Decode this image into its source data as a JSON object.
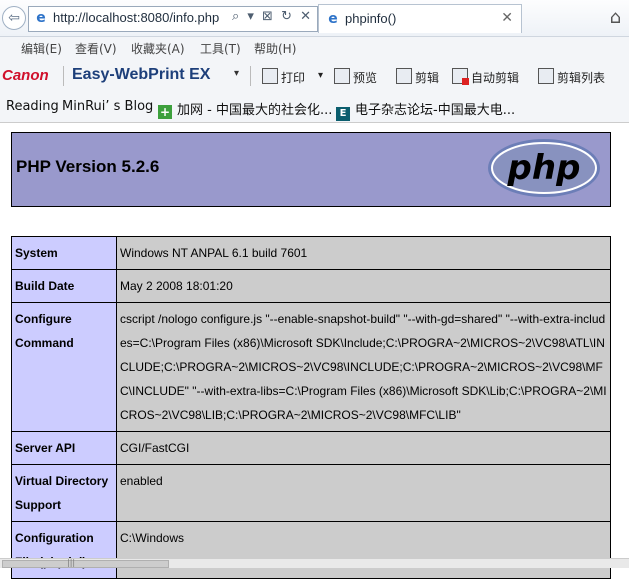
{
  "browser": {
    "url": "http://localhost:8080/info.php",
    "addr_tools": "⌕ ▾ ⊠ ↻ ✕",
    "tab_title": "phpinfo()",
    "tab_close": "✕",
    "home_icon": "⌂",
    "ie_glyph": "e",
    "back_glyph": "⇦"
  },
  "menu": [
    "编辑(E)",
    "查看(V)",
    "收藏夹(A)",
    "工具(T)",
    "帮助(H)"
  ],
  "toolbar": {
    "brand": "Canon",
    "product": "Easy-WebPrint EX",
    "product_arrow": "▾",
    "print": "打印",
    "print_arrow": "▾",
    "preview": "预览",
    "clip": "剪辑",
    "auto_clip": "自动剪辑",
    "clip_list": "剪辑列表"
  },
  "favorites": {
    "item1": "Reading",
    "item2": "MinRui’ s Blog",
    "item3": "加网 - 中国最大的社会化...",
    "item4": "电子杂志论坛-中国最大电...",
    "icon3_glyph": "+",
    "icon4_glyph": "E"
  },
  "page": {
    "title": "PHP Version 5.2.6",
    "logo_text": "php",
    "rows": [
      {
        "key": "System",
        "value": "Windows NT ANPAL 6.1 build 7601"
      },
      {
        "key": "Build Date",
        "value": "May 2 2008 18:01:20"
      },
      {
        "key": "Configure Command",
        "value": "cscript /nologo configure.js \"--enable-snapshot-build\" \"--with-gd=shared\" \"--with-extra-includes=C:\\Program Files (x86)\\Microsoft SDK\\Include;C:\\PROGRA~2\\MICROS~2\\VC98\\ATL\\INCLUDE;C:\\PROGRA~2\\MICROS~2\\VC98\\INCLUDE;C:\\PROGRA~2\\MICROS~2\\VC98\\MFC\\INCLUDE\" \"--with-extra-libs=C:\\Program Files (x86)\\Microsoft SDK\\Lib;C:\\PROGRA~2\\MICROS~2\\VC98\\LIB;C:\\PROGRA~2\\MICROS~2\\VC98\\MFC\\LIB\""
      },
      {
        "key": "Server API",
        "value": "CGI/FastCGI"
      },
      {
        "key": "Virtual Directory Support",
        "value": "enabled"
      },
      {
        "key": "Configuration File (php.ini)",
        "value": "C:\\Windows"
      }
    ]
  },
  "scrollbar": {
    "grip": "|||"
  },
  "colors": {
    "header_bg": "#9999cc",
    "key_bg": "#ccccff",
    "value_bg": "#cccccc",
    "canon_red": "#d0102b"
  }
}
